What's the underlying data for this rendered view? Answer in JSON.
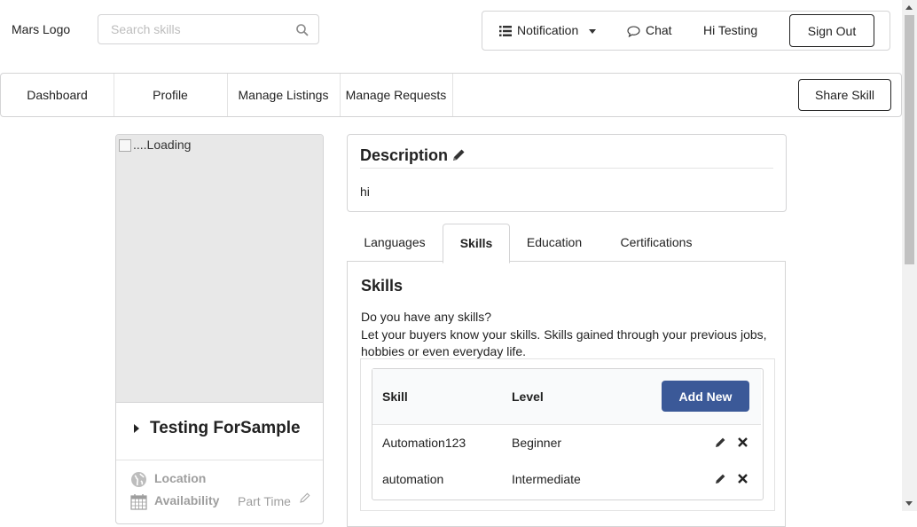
{
  "header": {
    "logo": "Mars Logo",
    "search_placeholder": "Search skills",
    "notification": "Notification",
    "chat": "Chat",
    "greeting": "Hi Testing",
    "sign_out": "Sign Out"
  },
  "nav": {
    "items": [
      "Dashboard",
      "Profile",
      "Manage Listings",
      "Manage Requests"
    ],
    "share_skill": "Share Skill"
  },
  "profile": {
    "image_alt": "....Loading",
    "name": "Testing ForSample",
    "location_label": "Location",
    "availability_label": "Availability",
    "availability_value": "Part Time"
  },
  "description": {
    "title": "Description",
    "text": "hi"
  },
  "tabs": [
    "Languages",
    "Skills",
    "Education",
    "Certifications"
  ],
  "active_tab": "Skills",
  "skills": {
    "title": "Skills",
    "question": "Do you have any skills?",
    "prompt": "Let your buyers know your skills. Skills gained through your previous jobs, hobbies or even everyday life.",
    "columns": [
      "Skill",
      "Level"
    ],
    "add_new": "Add New",
    "rows": [
      {
        "skill": "Automation123",
        "level": "Beginner"
      },
      {
        "skill": "automation",
        "level": "Intermediate"
      }
    ]
  },
  "colors": {
    "primary_button": "#3b5998",
    "border": "#d4d4d5",
    "muted_text": "#9e9e9e"
  },
  "icons": [
    "search-icon",
    "list-icon",
    "chat-bubble-icon",
    "pencil-icon",
    "globe-icon",
    "calendar-icon",
    "close-icon"
  ]
}
